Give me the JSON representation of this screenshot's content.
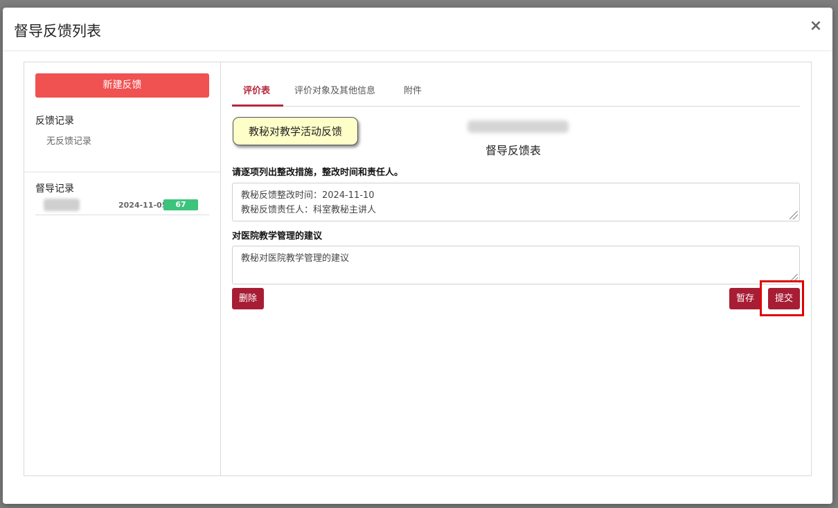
{
  "modal": {
    "title": "督导反馈列表",
    "close_label": "×"
  },
  "left": {
    "new_button": "新建反馈",
    "feedback_section": "反馈记录",
    "feedback_empty": "无反馈记录",
    "supervision_section": "督导记录",
    "records": [
      {
        "date": "2024-11-05",
        "score": "67"
      }
    ]
  },
  "tabs": [
    {
      "label": "评价表",
      "active": true
    },
    {
      "label": "评价对象及其他信息",
      "active": false
    },
    {
      "label": "附件",
      "active": false
    }
  ],
  "form": {
    "tooltip": "教秘对教学活动反馈",
    "title": "督导反馈表",
    "field1_label": "请逐项列出整改措施，整改时间和责任人。",
    "field1_line1": "教秘反馈整改时间：2024-11-10",
    "field1_line2": "教秘反馈责任人：科室教秘主讲人",
    "field2_label": "对医院教学管理的建议",
    "field2_value": "教秘对医院教学管理的建议"
  },
  "actions": {
    "delete": "删除",
    "save": "暂存",
    "submit": "提交"
  },
  "colors": {
    "primary": "#a71d34",
    "new_button": "#f05252",
    "badge": "#3cc47c",
    "highlight": "#e00000"
  }
}
